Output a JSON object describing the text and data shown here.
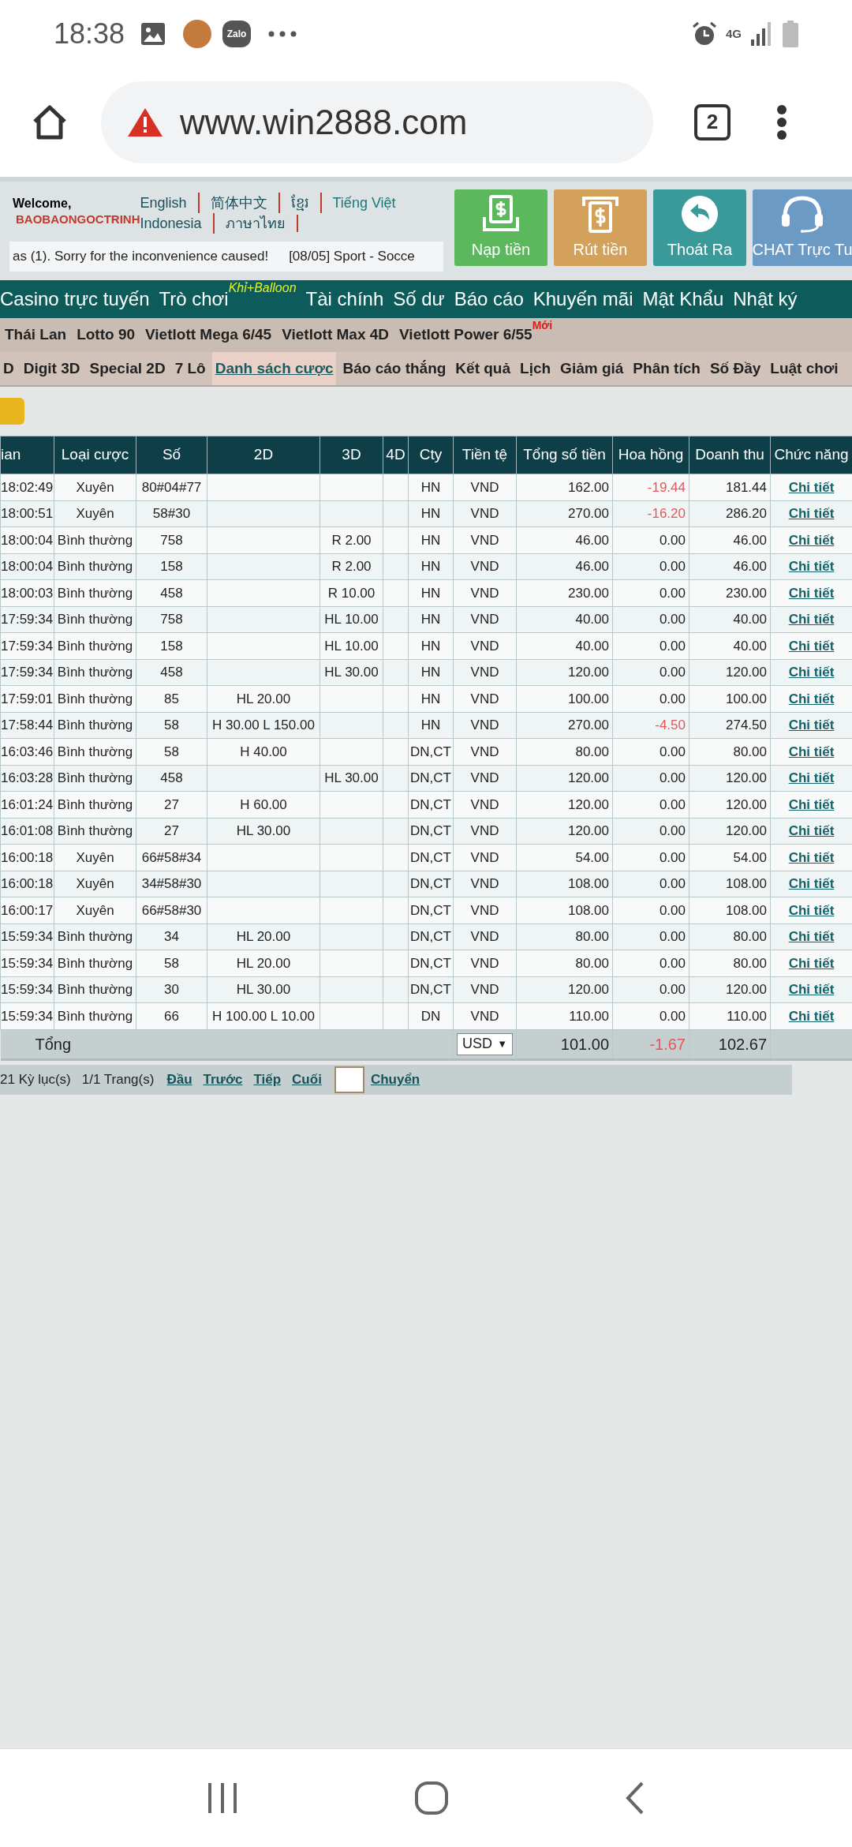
{
  "status_bar": {
    "time": "18:38",
    "zalo_label": "Zalo",
    "network": "4G"
  },
  "browser": {
    "url": "www.win2888.com",
    "tab_count": "2"
  },
  "header": {
    "welcome": "Welcome,",
    "username": "BAOBAONGOCTRINH",
    "languages": [
      {
        "label": "English",
        "selected": false
      },
      {
        "label": "简体中文",
        "selected": false
      },
      {
        "label": "ខ្មែរ",
        "selected": false
      },
      {
        "label": "Tiếng Việt",
        "selected": true
      },
      {
        "label": "Indonesia",
        "selected": false
      },
      {
        "label": "ภาษาไทย",
        "selected": false
      }
    ],
    "marquee": [
      "as (1). Sorry for the inconvenience caused!",
      "[08/05] Sport - Socce"
    ],
    "buttons": [
      {
        "kind": "deposit",
        "label": "Nạp tiền"
      },
      {
        "kind": "withdraw",
        "label": "Rút tiền"
      },
      {
        "kind": "logout",
        "label": "Thoát Ra"
      },
      {
        "kind": "chat",
        "label": "CHAT Trực Tu"
      }
    ]
  },
  "main_nav": [
    {
      "label": "Casino trực tuyến"
    },
    {
      "label": "Trò chơi",
      "badge": "Khỉ+Balloon"
    },
    {
      "label": "Tài chính"
    },
    {
      "label": "Số dư"
    },
    {
      "label": "Báo cáo"
    },
    {
      "label": "Khuyến mãi"
    },
    {
      "label": "Mật Khẩu"
    },
    {
      "label": "Nhật ký"
    }
  ],
  "game_nav": [
    {
      "label": "Thái Lan"
    },
    {
      "label": "Lotto 90"
    },
    {
      "label": "Vietlott Mega 6/45"
    },
    {
      "label": "Vietlott Max 4D"
    },
    {
      "label": "Vietlott Power 6/55",
      "badge": "Mới"
    }
  ],
  "sub_nav": [
    {
      "label": "D",
      "selected": false
    },
    {
      "label": "Digit 3D",
      "selected": false
    },
    {
      "label": "Special 2D",
      "selected": false
    },
    {
      "label": "7 Lô",
      "selected": false
    },
    {
      "label": "Danh sách cược",
      "selected": true
    },
    {
      "label": "Báo cáo thắng",
      "selected": false
    },
    {
      "label": "Kết quả",
      "selected": false
    },
    {
      "label": "Lịch",
      "selected": false
    },
    {
      "label": "Giảm giá",
      "selected": false
    },
    {
      "label": "Phân tích",
      "selected": false
    },
    {
      "label": "Số Đầy",
      "selected": false
    },
    {
      "label": "Luật chơi",
      "selected": false
    }
  ],
  "table": {
    "columns": [
      "ian",
      "Loại cược",
      "Số",
      "2D",
      "3D",
      "4D",
      "Cty",
      "Tiền tệ",
      "Tổng số tiền",
      "Hoa hồng",
      "Doanh thu",
      "Chức năng"
    ],
    "rows": [
      {
        "cells": [
          "18:02:49",
          "Xuyên",
          "80#04#77",
          "",
          "",
          "",
          "HN",
          "VND",
          "162.00",
          "-19.44",
          "181.44",
          "Chi tiết"
        ],
        "commission_negative": true
      },
      {
        "cells": [
          "18:00:51",
          "Xuyên",
          "58#30",
          "",
          "",
          "",
          "HN",
          "VND",
          "270.00",
          "-16.20",
          "286.20",
          "Chi tiết"
        ],
        "commission_negative": true
      },
      {
        "cells": [
          "18:00:04",
          "Bình thường",
          "758",
          "",
          "R 2.00",
          "",
          "HN",
          "VND",
          "46.00",
          "0.00",
          "46.00",
          "Chi tiết"
        ],
        "commission_negative": false
      },
      {
        "cells": [
          "18:00:04",
          "Bình thường",
          "158",
          "",
          "R 2.00",
          "",
          "HN",
          "VND",
          "46.00",
          "0.00",
          "46.00",
          "Chi tiết"
        ],
        "commission_negative": false
      },
      {
        "cells": [
          "18:00:03",
          "Bình thường",
          "458",
          "",
          "R 10.00",
          "",
          "HN",
          "VND",
          "230.00",
          "0.00",
          "230.00",
          "Chi tiết"
        ],
        "commission_negative": false
      },
      {
        "cells": [
          "17:59:34",
          "Bình thường",
          "758",
          "",
          "HL 10.00",
          "",
          "HN",
          "VND",
          "40.00",
          "0.00",
          "40.00",
          "Chi tiết"
        ],
        "commission_negative": false
      },
      {
        "cells": [
          "17:59:34",
          "Bình thường",
          "158",
          "",
          "HL 10.00",
          "",
          "HN",
          "VND",
          "40.00",
          "0.00",
          "40.00",
          "Chi tiết"
        ],
        "commission_negative": false
      },
      {
        "cells": [
          "17:59:34",
          "Bình thường",
          "458",
          "",
          "HL 30.00",
          "",
          "HN",
          "VND",
          "120.00",
          "0.00",
          "120.00",
          "Chi tiết"
        ],
        "commission_negative": false
      },
      {
        "cells": [
          "17:59:01",
          "Bình thường",
          "85",
          "HL 20.00",
          "",
          "",
          "HN",
          "VND",
          "100.00",
          "0.00",
          "100.00",
          "Chi tiết"
        ],
        "commission_negative": false
      },
      {
        "cells": [
          "17:58:44",
          "Bình thường",
          "58",
          "H 30.00 L 150.00",
          "",
          "",
          "HN",
          "VND",
          "270.00",
          "-4.50",
          "274.50",
          "Chi tiết"
        ],
        "commission_negative": true
      },
      {
        "cells": [
          "16:03:46",
          "Bình thường",
          "58",
          "H 40.00",
          "",
          "",
          "DN,CT",
          "VND",
          "80.00",
          "0.00",
          "80.00",
          "Chi tiết"
        ],
        "commission_negative": false
      },
      {
        "cells": [
          "16:03:28",
          "Bình thường",
          "458",
          "",
          "HL 30.00",
          "",
          "DN,CT",
          "VND",
          "120.00",
          "0.00",
          "120.00",
          "Chi tiết"
        ],
        "commission_negative": false
      },
      {
        "cells": [
          "16:01:24",
          "Bình thường",
          "27",
          "H 60.00",
          "",
          "",
          "DN,CT",
          "VND",
          "120.00",
          "0.00",
          "120.00",
          "Chi tiết"
        ],
        "commission_negative": false
      },
      {
        "cells": [
          "16:01:08",
          "Bình thường",
          "27",
          "HL 30.00",
          "",
          "",
          "DN,CT",
          "VND",
          "120.00",
          "0.00",
          "120.00",
          "Chi tiết"
        ],
        "commission_negative": false
      },
      {
        "cells": [
          "16:00:18",
          "Xuyên",
          "66#58#34",
          "",
          "",
          "",
          "DN,CT",
          "VND",
          "54.00",
          "0.00",
          "54.00",
          "Chi tiết"
        ],
        "commission_negative": false
      },
      {
        "cells": [
          "16:00:18",
          "Xuyên",
          "34#58#30",
          "",
          "",
          "",
          "DN,CT",
          "VND",
          "108.00",
          "0.00",
          "108.00",
          "Chi tiết"
        ],
        "commission_negative": false
      },
      {
        "cells": [
          "16:00:17",
          "Xuyên",
          "66#58#30",
          "",
          "",
          "",
          "DN,CT",
          "VND",
          "108.00",
          "0.00",
          "108.00",
          "Chi tiết"
        ],
        "commission_negative": false
      },
      {
        "cells": [
          "15:59:34",
          "Bình thường",
          "34",
          "HL 20.00",
          "",
          "",
          "DN,CT",
          "VND",
          "80.00",
          "0.00",
          "80.00",
          "Chi tiết"
        ],
        "commission_negative": false
      },
      {
        "cells": [
          "15:59:34",
          "Bình thường",
          "58",
          "HL 20.00",
          "",
          "",
          "DN,CT",
          "VND",
          "80.00",
          "0.00",
          "80.00",
          "Chi tiết"
        ],
        "commission_negative": false
      },
      {
        "cells": [
          "15:59:34",
          "Bình thường",
          "30",
          "HL 30.00",
          "",
          "",
          "DN,CT",
          "VND",
          "120.00",
          "0.00",
          "120.00",
          "Chi tiết"
        ],
        "commission_negative": false
      },
      {
        "cells": [
          "15:59:34",
          "Bình thường",
          "66",
          "H 100.00 L 10.00",
          "",
          "",
          "DN",
          "VND",
          "110.00",
          "0.00",
          "110.00",
          "Chi tiết"
        ],
        "commission_negative": false
      }
    ],
    "total": {
      "label": "Tổng",
      "currency": "USD",
      "dropdown_arrow": "▼",
      "amount": "101.00",
      "commission": "-1.67",
      "commission_negative": true,
      "revenue": "102.67"
    }
  },
  "pagination": {
    "records": "21 Kỳ lục(s)",
    "pages": "1/1 Trang(s)",
    "links": [
      "Đầu",
      "Trước",
      "Tiếp",
      "Cuối"
    ],
    "go": "Chuyển"
  }
}
